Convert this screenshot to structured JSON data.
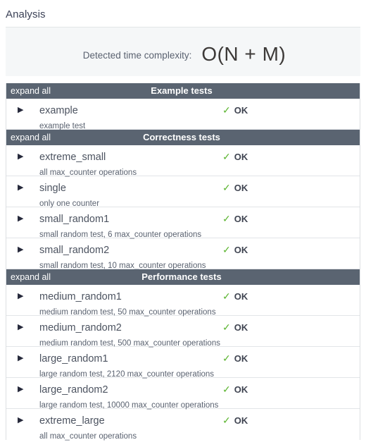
{
  "page": {
    "title": "Analysis"
  },
  "complexity": {
    "label": "Detected time complexity:",
    "value": "O(N + M)"
  },
  "icons": {
    "caret": "▶",
    "check": "✓"
  },
  "labels": {
    "expand_all": "expand all",
    "status_ok": "OK"
  },
  "sections": [
    {
      "expand_all": "expand all",
      "title": "Example tests",
      "tests": [
        {
          "name": "example",
          "desc": "example test",
          "status": "OK",
          "caret": "▶",
          "check": "✓"
        }
      ]
    },
    {
      "expand_all": "expand all",
      "title": "Correctness tests",
      "tests": [
        {
          "name": "extreme_small",
          "desc": "all max_counter operations",
          "status": "OK",
          "caret": "▶",
          "check": "✓"
        },
        {
          "name": "single",
          "desc": "only one counter",
          "status": "OK",
          "caret": "▶",
          "check": "✓"
        },
        {
          "name": "small_random1",
          "desc": "small random test, 6 max_counter operations",
          "status": "OK",
          "caret": "▶",
          "check": "✓"
        },
        {
          "name": "small_random2",
          "desc": "small random test, 10 max_counter operations",
          "status": "OK",
          "caret": "▶",
          "check": "✓"
        }
      ]
    },
    {
      "expand_all": "expand all",
      "title": "Performance tests",
      "tests": [
        {
          "name": "medium_random1",
          "desc": "medium random test, 50 max_counter operations",
          "status": "OK",
          "caret": "▶",
          "check": "✓"
        },
        {
          "name": "medium_random2",
          "desc": "medium random test, 500 max_counter operations",
          "status": "OK",
          "caret": "▶",
          "check": "✓"
        },
        {
          "name": "large_random1",
          "desc": "large random test, 2120 max_counter operations",
          "status": "OK",
          "caret": "▶",
          "check": "✓"
        },
        {
          "name": "large_random2",
          "desc": "large random test, 10000 max_counter operations",
          "status": "OK",
          "caret": "▶",
          "check": "✓"
        },
        {
          "name": "extreme_large",
          "desc": "all max_counter operations",
          "status": "OK",
          "caret": "▶",
          "check": "✓"
        }
      ]
    }
  ],
  "colors": {
    "header_bar": "#5a6471",
    "panel_bg": "#f5f7f8",
    "check_green": "#5cb531",
    "text_primary": "#4c5360"
  }
}
